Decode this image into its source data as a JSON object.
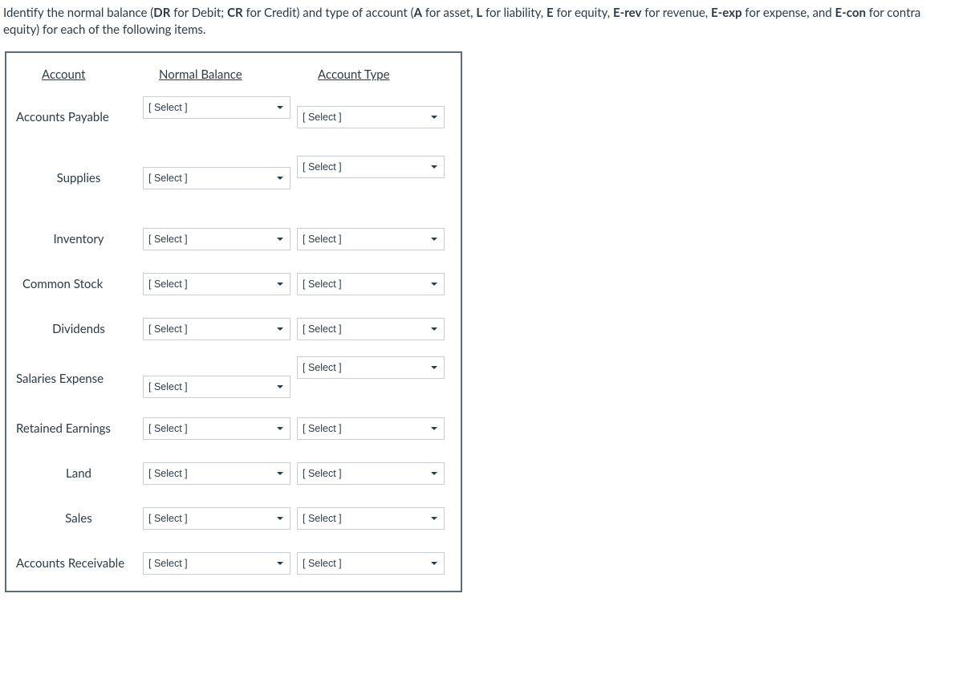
{
  "instructions": {
    "pre": "Identify the normal balance (",
    "dr_b": "DR",
    "dr_t": " for Debit; ",
    "cr_b": "CR",
    "cr_t": " for Credit) and type of account (",
    "a_b": "A",
    "a_t": " for asset, ",
    "l_b": "L",
    "l_t": " for liability, ",
    "e_b": "E",
    "e_t": " for equity, ",
    "erev_b": "E-rev",
    "erev_t": " for revenue, ",
    "eexp_b": "E-exp",
    "eexp_t": " for expense, and ",
    "econ_b": "E-con",
    "econ_t": " for contra equity) for each of the following items."
  },
  "headers": {
    "account": "Account",
    "normal": "Normal Balance",
    "type": "Account Type"
  },
  "select_placeholder": "[ Select ]",
  "rows": [
    {
      "label": "Accounts Payable"
    },
    {
      "label": "Supplies"
    },
    {
      "label": "Inventory"
    },
    {
      "label": "Common Stock"
    },
    {
      "label": "Dividends"
    },
    {
      "label": "Salaries Expense"
    },
    {
      "label": "Retained Earnings"
    },
    {
      "label": "Land"
    },
    {
      "label": "Sales"
    },
    {
      "label": "Accounts Receivable"
    }
  ]
}
